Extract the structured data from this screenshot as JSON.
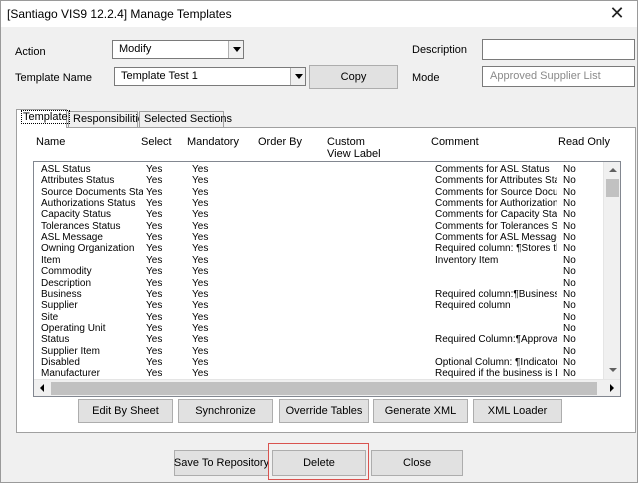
{
  "window": {
    "title": "[Santiago VIS9 12.2.4] Manage Templates",
    "close_glyph": "✕"
  },
  "form": {
    "action_label": "Action",
    "action_value": "Modify",
    "template_name_label": "Template Name",
    "template_name_value": "Template Test 1",
    "copy_button": "Copy",
    "description_label": "Description",
    "description_value": "",
    "mode_label": "Mode",
    "mode_placeholder": "Approved Supplier List"
  },
  "tabs": [
    "Template",
    "Responsibilities",
    "Selected Sections"
  ],
  "grid": {
    "headers": {
      "name": "Name",
      "select": "Select",
      "mandatory": "Mandatory",
      "order_by": "Order By",
      "custom_view_label_1": "Custom",
      "custom_view_label_2": "View Label",
      "comment": "Comment",
      "read_only": "Read Only"
    },
    "rows": [
      {
        "name": "ASL Status",
        "select": "Yes",
        "mandatory": "Yes",
        "order_by": "",
        "custom": "",
        "comment": "Comments for ASL Status",
        "read_only": "No"
      },
      {
        "name": "Attributes Status",
        "select": "Yes",
        "mandatory": "Yes",
        "order_by": "",
        "custom": "",
        "comment": "Comments for Attributes Sta",
        "read_only": "No"
      },
      {
        "name": "Source Documents Stat",
        "select": "Yes",
        "mandatory": "Yes",
        "order_by": "",
        "custom": "",
        "comment": "Comments for Source Docum",
        "read_only": "No"
      },
      {
        "name": "Authorizations Status",
        "select": "Yes",
        "mandatory": "Yes",
        "order_by": "",
        "custom": "",
        "comment": "Comments for Authorizations",
        "read_only": "No"
      },
      {
        "name": "Capacity Status",
        "select": "Yes",
        "mandatory": "Yes",
        "order_by": "",
        "custom": "",
        "comment": "Comments for Capacity Statu",
        "read_only": "No"
      },
      {
        "name": "Tolerances Status",
        "select": "Yes",
        "mandatory": "Yes",
        "order_by": "",
        "custom": "",
        "comment": "Comments for Tolerances Sta",
        "read_only": "No"
      },
      {
        "name": "ASL Message",
        "select": "Yes",
        "mandatory": "Yes",
        "order_by": "",
        "custom": "",
        "comment": "Comments for ASL Message",
        "read_only": "No"
      },
      {
        "name": "Owning Organization",
        "select": "Yes",
        "mandatory": "Yes",
        "order_by": "",
        "custom": "",
        "comment": "Required column: ¶Stores the",
        "read_only": "No"
      },
      {
        "name": "Item",
        "select": "Yes",
        "mandatory": "Yes",
        "order_by": "",
        "custom": "",
        "comment": "Inventory Item",
        "read_only": "No"
      },
      {
        "name": "Commodity",
        "select": "Yes",
        "mandatory": "Yes",
        "order_by": "",
        "custom": "",
        "comment": "",
        "read_only": "No"
      },
      {
        "name": "Description",
        "select": "Yes",
        "mandatory": "Yes",
        "order_by": "",
        "custom": "",
        "comment": "",
        "read_only": "No"
      },
      {
        "name": "Business",
        "select": "Yes",
        "mandatory": "Yes",
        "order_by": "",
        "custom": "",
        "comment": "Required column:¶Business t",
        "read_only": "No"
      },
      {
        "name": "Supplier",
        "select": "Yes",
        "mandatory": "Yes",
        "order_by": "",
        "custom": "",
        "comment": "Required column",
        "read_only": "No"
      },
      {
        "name": "Site",
        "select": "Yes",
        "mandatory": "Yes",
        "order_by": "",
        "custom": "",
        "comment": "",
        "read_only": "No"
      },
      {
        "name": "Operating Unit",
        "select": "Yes",
        "mandatory": "Yes",
        "order_by": "",
        "custom": "",
        "comment": "",
        "read_only": "No"
      },
      {
        "name": "Status",
        "select": "Yes",
        "mandatory": "Yes",
        "order_by": "",
        "custom": "",
        "comment": "Required Column:¶Approval/",
        "read_only": "No"
      },
      {
        "name": "Supplier Item",
        "select": "Yes",
        "mandatory": "Yes",
        "order_by": "",
        "custom": "",
        "comment": "",
        "read_only": "No"
      },
      {
        "name": "Disabled",
        "select": "Yes",
        "mandatory": "Yes",
        "order_by": "",
        "custom": "",
        "comment": "Optional Column: ¶Indicator",
        "read_only": "No"
      },
      {
        "name": "Manufacturer",
        "select": "Yes",
        "mandatory": "Yes",
        "order_by": "",
        "custom": "",
        "comment": "Required if the business is Di",
        "read_only": "No"
      }
    ]
  },
  "panel_buttons": [
    "Edit By Sheet",
    "Synchronize",
    "Override Tables",
    "Generate XML",
    "XML Loader"
  ],
  "footer_buttons": {
    "save": "Save To Repository",
    "delete": "Delete",
    "close": "Close"
  },
  "highlight_color": "#d9534f"
}
